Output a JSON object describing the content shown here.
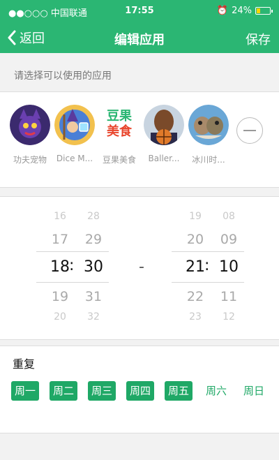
{
  "status_bar": {
    "carrier": "●●○○○ 中国联通",
    "time": "17:55",
    "battery": "24%"
  },
  "nav": {
    "back_label": "返回",
    "title": "编辑应用",
    "save_label": "保存"
  },
  "hint": "请选择可以使用的应用",
  "apps": [
    {
      "label": "功夫宠物",
      "icon": "kungfu-pet-app-icon",
      "color": "#6a3fb0"
    },
    {
      "label": "Dice M...",
      "icon": "dice-mage-app-icon",
      "color": "#4a7fd6"
    },
    {
      "label": "豆果美食",
      "icon": "douguo-food-app-icon",
      "color": "#2bb673"
    },
    {
      "label": "Baller...",
      "icon": "baller-app-icon",
      "color": "#7a4a2a"
    },
    {
      "label": "冰川时...",
      "icon": "ice-age-app-icon",
      "color": "#6aa7d6"
    }
  ],
  "douguo_logo": {
    "line1": "豆果",
    "line2": "美食"
  },
  "picker": {
    "start": {
      "hours": [
        "16",
        "17",
        "18",
        "19",
        "20"
      ],
      "minutes": [
        "28",
        "29",
        "30",
        "31",
        "32"
      ]
    },
    "end": {
      "hours": [
        "19",
        "20",
        "21",
        "22",
        "23"
      ],
      "minutes": [
        "08",
        "09",
        "10",
        "11",
        "12"
      ]
    },
    "colon": ":",
    "separator": "-"
  },
  "repeat": {
    "title": "重复",
    "days": [
      {
        "label": "周一",
        "selected": true
      },
      {
        "label": "周二",
        "selected": true
      },
      {
        "label": "周三",
        "selected": true
      },
      {
        "label": "周四",
        "selected": true
      },
      {
        "label": "周五",
        "selected": true
      },
      {
        "label": "周六",
        "selected": false
      },
      {
        "label": "周日",
        "selected": false
      }
    ]
  }
}
